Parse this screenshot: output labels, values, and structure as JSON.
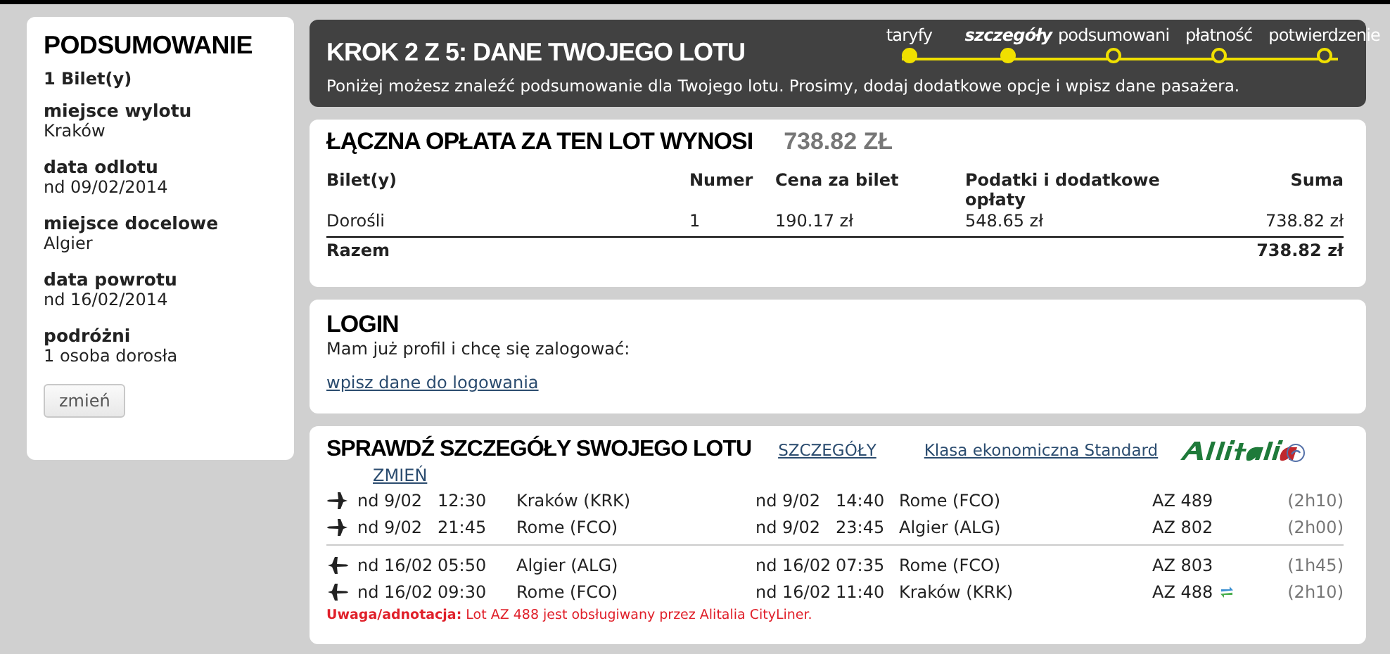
{
  "summary": {
    "title": "PODSUMOWANIE",
    "tickets": "1 Bilet(y)",
    "fields": [
      {
        "label": "miejsce wylotu",
        "value": "Kraków"
      },
      {
        "label": "data odlotu",
        "value": "nd 09/02/2014"
      },
      {
        "label": "miejsce docelowe",
        "value": "Algier"
      },
      {
        "label": "data powrotu",
        "value": "nd 16/02/2014"
      },
      {
        "label": "podróżni",
        "value": "1 osoba dorosła"
      }
    ],
    "change_button": "zmień"
  },
  "header": {
    "title": "KROK 2 Z 5: DANE TWOJEGO LOTU",
    "description": "Poniżej możesz znaleźć podsumowanie dla Twojego lotu. Prosimy, dodaj dodatkowe opcje i wpisz dane pasażera.",
    "steps": [
      {
        "label": "taryfy",
        "selected": false,
        "completed": true
      },
      {
        "label": "szczegóły",
        "selected": true,
        "completed": true
      },
      {
        "label": "podsumowani",
        "selected": false,
        "completed": false
      },
      {
        "label": "płatność",
        "selected": false,
        "completed": false
      },
      {
        "label": "potwierdzenie",
        "selected": false,
        "completed": false
      }
    ]
  },
  "fee": {
    "title": "ŁĄCZNA OPŁATA ZA TEN LOT WYNOSI",
    "total": "738.82 ZŁ",
    "columns": [
      "Bilet(y)",
      "Numer",
      "Cena za bilet",
      "Podatki i dodatkowe opłaty",
      "Suma"
    ],
    "rows": [
      [
        "Dorośli",
        "1",
        "190.17 zł",
        "548.65 zł",
        "738.82 zł"
      ]
    ],
    "total_row": {
      "label": "Razem",
      "sum": "738.82 zł"
    }
  },
  "login": {
    "title": "LOGIN",
    "text": "Mam już profil i chcę się zalogować:",
    "link": "wpisz dane do logowania"
  },
  "flights": {
    "title": "SPRAWDŹ SZCZEGÓŁY SWOJEGO LOTU",
    "details_link": "SZCZEGÓŁY",
    "class_link": "Klasa ekonomiczna Standard",
    "change_link": "ZMIEŃ",
    "legs": [
      {
        "kind": "outbound",
        "segments": [
          {
            "dep_date": "nd 9/02",
            "dep_time": "12:30",
            "from": "Kraków (KRK)",
            "arr_date": "nd 9/02",
            "arr_time": "14:40",
            "to": "Rome (FCO)",
            "flight": "AZ 489",
            "partner": false,
            "duration": "(2h10)"
          },
          {
            "dep_date": "nd 9/02",
            "dep_time": "21:45",
            "from": "Rome (FCO)",
            "arr_date": "nd 9/02",
            "arr_time": "23:45",
            "to": "Algier (ALG)",
            "flight": "AZ 802",
            "partner": false,
            "duration": "(2h00)"
          }
        ]
      },
      {
        "kind": "return",
        "segments": [
          {
            "dep_date": "nd 16/02",
            "dep_time": "05:50",
            "from": "Algier (ALG)",
            "arr_date": "nd 16/02",
            "arr_time": "07:35",
            "to": "Rome (FCO)",
            "flight": "AZ 803",
            "partner": false,
            "duration": "(1h45)"
          },
          {
            "dep_date": "nd 16/02",
            "dep_time": "09:30",
            "from": "Rome (FCO)",
            "arr_date": "nd 16/02",
            "arr_time": "11:40",
            "to": "Kraków (KRK)",
            "flight": "AZ 488",
            "partner": true,
            "duration": "(2h10)"
          }
        ]
      }
    ],
    "note": "**Uwaga/adnotacja:** Lot AZ 488 jest obsługiwany przez Alitalia CityLiner."
  }
}
